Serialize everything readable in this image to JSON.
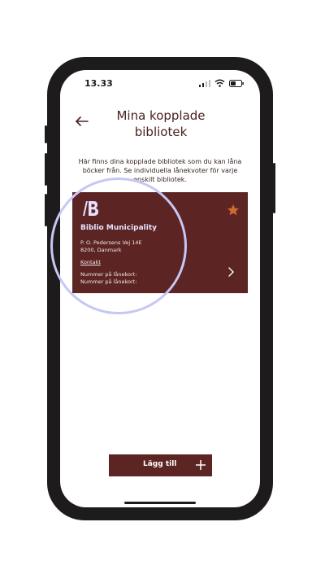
{
  "status_bar": {
    "time": "13.33"
  },
  "header": {
    "title": "Mina kopplade bibliotek"
  },
  "intro": {
    "text": "Här finns dina kopplade bibliotek som du kan låna böcker från. Se individuella lånekvoter för varje enskilt bibliotek."
  },
  "library_card": {
    "name": "Biblio Municipality",
    "address_line1": "P. O. Pedersens Vej 14E",
    "address_line2": "8200, Danmark",
    "contact_label": "Kontakt",
    "card_number_label_1": "Nummer på lånekort:",
    "card_number_label_2": "Nummer på lånekort:"
  },
  "add_button": {
    "label": "Lägg till"
  },
  "colors": {
    "card": "#5c2523",
    "star": "#d06a2f",
    "halo": "#c6c7f6",
    "title": "#4a2220"
  }
}
